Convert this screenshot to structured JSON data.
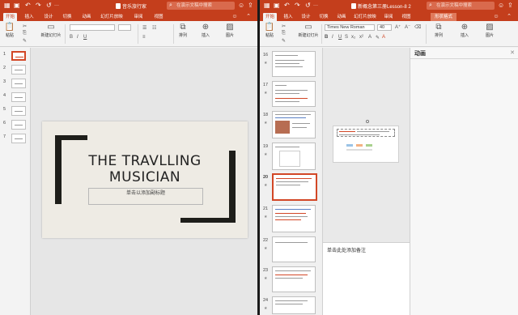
{
  "left_window": {
    "title": "音乐旅行家",
    "search_placeholder": "在演示文稿中搜索",
    "tabs": [
      "开始",
      "插入",
      "设计",
      "切换",
      "动画",
      "幻灯片放映",
      "审阅",
      "视图"
    ],
    "ribbon": {
      "paste": "粘贴",
      "new_slide": "新建幻灯片",
      "arrange": "排列",
      "insert": "插入",
      "picture": "图片"
    },
    "thumb_numbers": [
      "1",
      "2",
      "3",
      "4",
      "5",
      "6",
      "7"
    ],
    "slide": {
      "title_line1": "THE TRAVLLING",
      "title_line2": "MUSICIAN",
      "subtitle": "单击以添加副标题"
    }
  },
  "right_window": {
    "title": "新概念第三册Lesson-8 2",
    "search_placeholder": "在演示文稿中搜索",
    "tabs": [
      "开始",
      "插入",
      "设计",
      "切换",
      "动画",
      "幻灯片放映",
      "审阅",
      "视图",
      "形状格式"
    ],
    "ribbon": {
      "paste": "粘贴",
      "new_slide": "新建幻灯片",
      "font_name": "Times New Roman",
      "font_size": "40",
      "arrange": "排列",
      "insert": "插入",
      "picture": "图片"
    },
    "thumb_numbers": [
      "16",
      "17",
      "18",
      "19",
      "20",
      "21",
      "22",
      "23",
      "24"
    ],
    "selected_thumb": "20",
    "anim_pane_title": "动画",
    "notes_placeholder": "单击此处添加备注"
  },
  "colors": {
    "accent": "#c43e1c",
    "slide_bg": "#eeebe4",
    "bracket": "#1e1e1a",
    "selection": "#d24726"
  }
}
